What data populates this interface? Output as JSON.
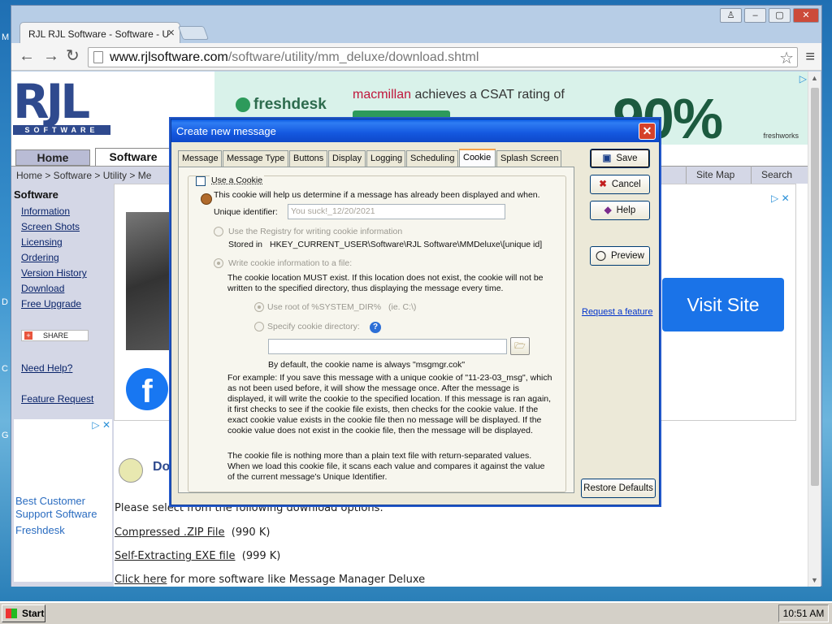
{
  "desktop_letters": [
    "M",
    "D",
    "C",
    "G"
  ],
  "browser": {
    "tab_title": "RJL RJL Software - Software - U",
    "tab_close": "×",
    "window_controls": [
      "♙",
      "–",
      "▢",
      "✕"
    ],
    "url_host": "www.rjlsoftware.com",
    "url_path": "/software/utility/mm_deluxe/download.shtml",
    "star": "☆",
    "menu": "≡",
    "nav": {
      "back": "←",
      "forward": "→",
      "reload": "↻"
    }
  },
  "site": {
    "logo_main": "RJL",
    "logo_sub": "SOFTWARE",
    "top_ad": {
      "brand": "freshdesk",
      "headline_brand": "macmillan",
      "headline_rest": " achieves a CSAT rating of",
      "big": "90%",
      "footer": "freshworks",
      "choice": "▷"
    },
    "tabs": {
      "home": "Home",
      "software": "Software"
    },
    "breadcrumb": "Home  >  Software  >  Utility  >  Me",
    "right_links": [
      "Site Map",
      "Search"
    ],
    "sidebar": {
      "title": "Software",
      "links": [
        "Information",
        "Screen Shots",
        "Licensing",
        "Ordering",
        "Version History",
        "Download",
        "Free Upgrade"
      ],
      "share": "SHARE",
      "need_help": "Need Help?",
      "feature_request": "Feature Request",
      "ad_lines": [
        "Best Customer",
        "Support Software",
        "Freshdesk"
      ],
      "ad_choice": "▷ ✕"
    },
    "content": {
      "fb": "f",
      "ad_choice": "▷ ✕",
      "visit_site": "Visit Site",
      "download_heading": "Do",
      "select_text": "Please select from the following download options:",
      "zip_link": "Compressed .ZIP File",
      "zip_size": "(990 K)",
      "exe_link": "Self-Extracting EXE file",
      "exe_size": "(999 K)",
      "click_here": "Click here",
      "more_text": " for more software like Message Manager Deluxe"
    }
  },
  "dialog": {
    "title": "Create new message",
    "close": "✕",
    "tabs": [
      "Message",
      "Message Type",
      "Buttons",
      "Display",
      "Logging",
      "Scheduling",
      "Cookie",
      "Splash Screen"
    ],
    "active_tab": "Cookie",
    "use_cookie_label": "Use a Cookie",
    "use_cookie_checked": false,
    "intro": "This cookie will help us determine if a message has already been displayed and when.",
    "uid_label": "Unique identifier:",
    "uid_value": "You suck!_12/20/2021",
    "registry_label": "Use the Registry for writing cookie information",
    "stored_in_label": "Stored in",
    "stored_in_value": "HKEY_CURRENT_USER\\Software\\RJL Software\\MMDeluxe\\[unique id]",
    "file_label": "Write cookie information to a file:",
    "file_note": "The cookie location MUST exist. If this location does not exist, the cookie will not be written to the specified directory, thus displaying the message every time.",
    "use_root_label": "Use root of %SYSTEM_DIR%",
    "use_root_hint": "(ie. C:\\)",
    "specify_dir_label": "Specify cookie directory:",
    "help_icon": "?",
    "folder_icon": "🗁",
    "default_name": "By default, the cookie name is always \"msgmgr.cok\"",
    "example": "For example: If you save this message with a unique cookie of \"11-23-03_msg\", which as not been used before, it will show the message once. After the message is displayed, it will write the cookie to the specified location. If this message is ran again, it first checks to see if the cookie file exists, then checks for the cookie value. If the exact cookie value exists in the cookie file then no message will be displayed. If the cookie value does not exist in the cookie file, then the message will be displayed.",
    "plain_text": "The cookie file is nothing more than a plain text file with return-separated values. When we load this cookie file, it scans each value and compares it against the value of the current message's Unique Identifier.",
    "buttons": {
      "save": "Save",
      "save_icon": "▣",
      "cancel": "Cancel",
      "cancel_icon": "✖",
      "help": "Help",
      "help_icon": "◆",
      "preview": "Preview",
      "preview_icon": "◯"
    },
    "request_feature": "Request a feature",
    "restore_defaults": "Restore Defaults"
  },
  "taskbar": {
    "start": "Start",
    "clock": "10:51 AM"
  }
}
